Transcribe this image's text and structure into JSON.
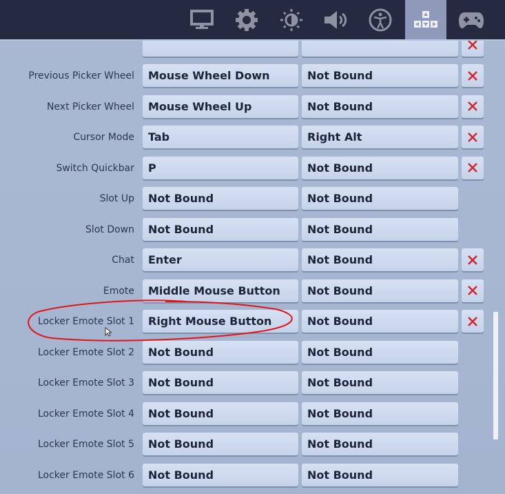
{
  "header": {
    "tabs": [
      {
        "icon": "monitor-icon",
        "name": "video"
      },
      {
        "icon": "gear-icon",
        "name": "game"
      },
      {
        "icon": "brightness-icon",
        "name": "brightness"
      },
      {
        "icon": "speaker-icon",
        "name": "audio"
      },
      {
        "icon": "accessibility-icon",
        "name": "accessibility"
      },
      {
        "icon": "keyboard-arrows-icon",
        "name": "input",
        "selected": true
      },
      {
        "icon": "gamepad-icon",
        "name": "controller"
      }
    ]
  },
  "bindings": [
    {
      "action": "",
      "primary": "",
      "secondary": "",
      "clear": true
    },
    {
      "action": "Previous Picker Wheel",
      "primary": "Mouse Wheel Down",
      "secondary": "Not Bound",
      "clear": true
    },
    {
      "action": "Next Picker Wheel",
      "primary": "Mouse Wheel Up",
      "secondary": "Not Bound",
      "clear": true
    },
    {
      "action": "Cursor Mode",
      "primary": "Tab",
      "secondary": "Right Alt",
      "clear": true
    },
    {
      "action": "Switch Quickbar",
      "primary": "P",
      "secondary": "Not Bound",
      "clear": true
    },
    {
      "action": "Slot Up",
      "primary": "Not Bound",
      "secondary": "Not Bound",
      "clear": false
    },
    {
      "action": "Slot Down",
      "primary": "Not Bound",
      "secondary": "Not Bound",
      "clear": false
    },
    {
      "action": "Chat",
      "primary": "Enter",
      "secondary": "Not Bound",
      "clear": true
    },
    {
      "action": "Emote",
      "primary": "Middle Mouse Button",
      "secondary": "Not Bound",
      "clear": true
    },
    {
      "action": "Locker Emote Slot 1",
      "primary": "Right Mouse Button",
      "secondary": "Not Bound",
      "clear": true
    },
    {
      "action": "Locker Emote Slot 2",
      "primary": "Not Bound",
      "secondary": "Not Bound",
      "clear": false
    },
    {
      "action": "Locker Emote Slot 3",
      "primary": "Not Bound",
      "secondary": "Not Bound",
      "clear": false
    },
    {
      "action": "Locker Emote Slot 4",
      "primary": "Not Bound",
      "secondary": "Not Bound",
      "clear": false
    },
    {
      "action": "Locker Emote Slot 5",
      "primary": "Not Bound",
      "secondary": "Not Bound",
      "clear": false
    },
    {
      "action": "Locker Emote Slot 6",
      "primary": "Not Bound",
      "secondary": "Not Bound",
      "clear": false
    }
  ],
  "colors": {
    "header": "#262a40",
    "selected_tab": "#8f9aba",
    "clear_x": "#d0282e",
    "annotation": "#e0141a"
  }
}
